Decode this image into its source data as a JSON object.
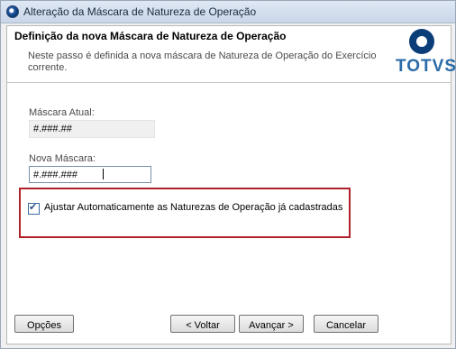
{
  "window": {
    "title": "Alteração da Máscara de Natureza de Operação"
  },
  "header": {
    "title": "Definição da nova Máscara de Natureza de Operação",
    "description": "Neste passo é definida a nova máscara de Natureza de Operação do Exercício corrente.",
    "logo_text": "TOTVS"
  },
  "form": {
    "current_mask_label": "Máscara Atual:",
    "current_mask_value": "#.###.##",
    "new_mask_label": "Nova Máscara:",
    "new_mask_value": "#.###.###",
    "auto_adjust_label": "Ajustar Automaticamente as Naturezas de Operação já cadastradas",
    "auto_adjust_checked": true
  },
  "buttons": {
    "options": "Opções",
    "back": "< Voltar",
    "next": "Avançar >",
    "cancel": "Cancelar"
  }
}
